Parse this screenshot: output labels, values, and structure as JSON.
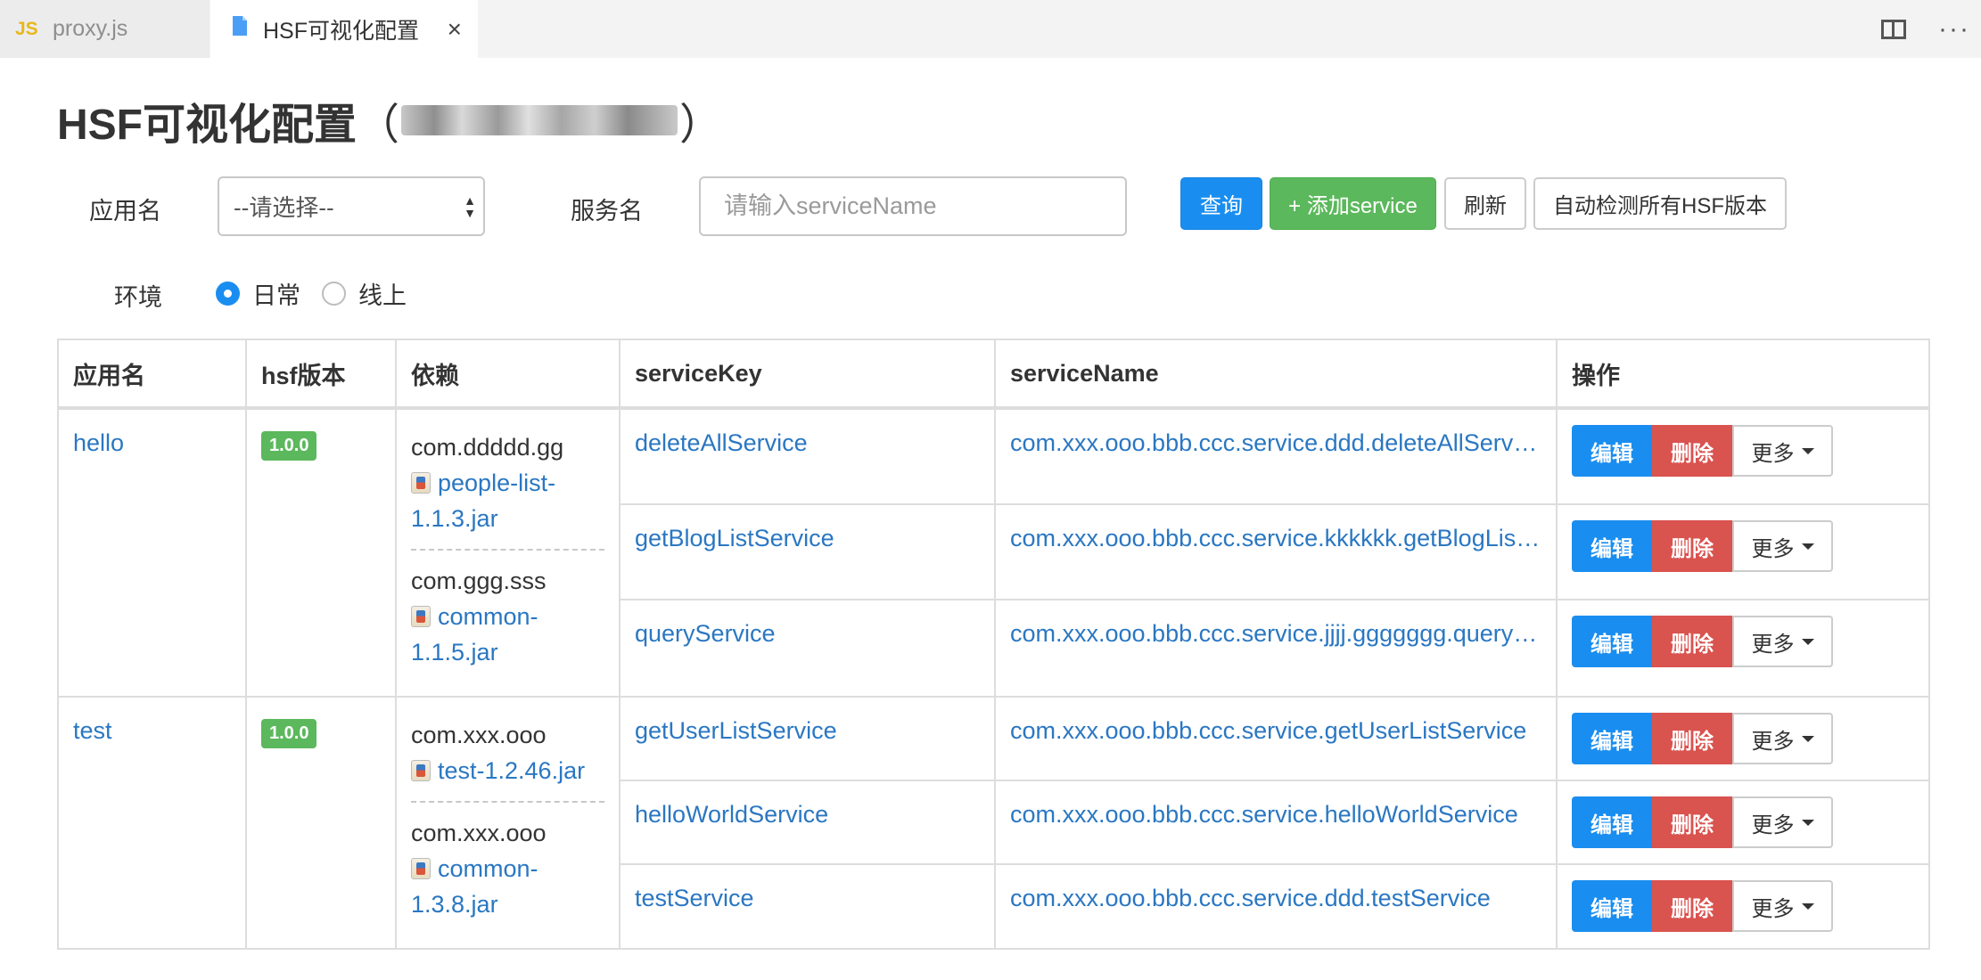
{
  "editor_tabs": [
    {
      "badge": "JS",
      "label": "proxy.js",
      "active": false
    },
    {
      "label": "HSF可视化配置",
      "active": true,
      "close": "×"
    }
  ],
  "toolbar_icons": [
    "split-editor-icon",
    "more-actions-icon"
  ],
  "page": {
    "title": "HSF可视化配置",
    "title_open_paren": "（",
    "title_close_paren": "）"
  },
  "filters": {
    "app_label": "应用名",
    "app_select_value": "--请选择--",
    "service_label": "服务名",
    "service_placeholder": "请输入serviceName",
    "env_label": "环境",
    "env_options": [
      {
        "label": "日常",
        "checked": true
      },
      {
        "label": "线上",
        "checked": false
      }
    ]
  },
  "buttons": {
    "query": "查询",
    "add_service": "+ 添加service",
    "refresh": "刷新",
    "detect": "自动检测所有HSF版本"
  },
  "table": {
    "headers": [
      "应用名",
      "hsf版本",
      "依赖",
      "serviceKey",
      "serviceName",
      "操作"
    ],
    "action_labels": {
      "edit": "编辑",
      "delete": "删除",
      "more": "更多"
    },
    "apps": [
      {
        "name": "hello",
        "version": "1.0.0",
        "deps": [
          {
            "pkg": "com.ddddd.gg",
            "jar": "people-list-1.1.3.jar"
          },
          {
            "pkg": "com.ggg.sss",
            "jar": "common-1.1.5.jar"
          }
        ],
        "services": [
          {
            "key": "deleteAllService",
            "name": "com.xxx.ooo.bbb.ccc.service.ddd.deleteAllService"
          },
          {
            "key": "getBlogListService",
            "name": "com.xxx.ooo.bbb.ccc.service.kkkkkk.getBlogListService"
          },
          {
            "key": "queryService",
            "name": "com.xxx.ooo.bbb.ccc.service.jjjj.ggggggg.queryService"
          }
        ]
      },
      {
        "name": "test",
        "version": "1.0.0",
        "deps": [
          {
            "pkg": "com.xxx.ooo",
            "jar": "test-1.2.46.jar"
          },
          {
            "pkg": "com.xxx.ooo",
            "jar": "common-1.3.8.jar"
          }
        ],
        "services": [
          {
            "key": "getUserListService",
            "name": "com.xxx.ooo.bbb.ccc.service.getUserListService"
          },
          {
            "key": "helloWorldService",
            "name": "com.xxx.ooo.bbb.ccc.service.helloWorldService"
          },
          {
            "key": "testService",
            "name": "com.xxx.ooo.bbb.ccc.service.ddd.testService"
          }
        ]
      }
    ]
  },
  "colors": {
    "primary": "#1a8ef0",
    "success": "#5cb85c",
    "danger": "#d9534f",
    "link": "#2a77c2"
  }
}
